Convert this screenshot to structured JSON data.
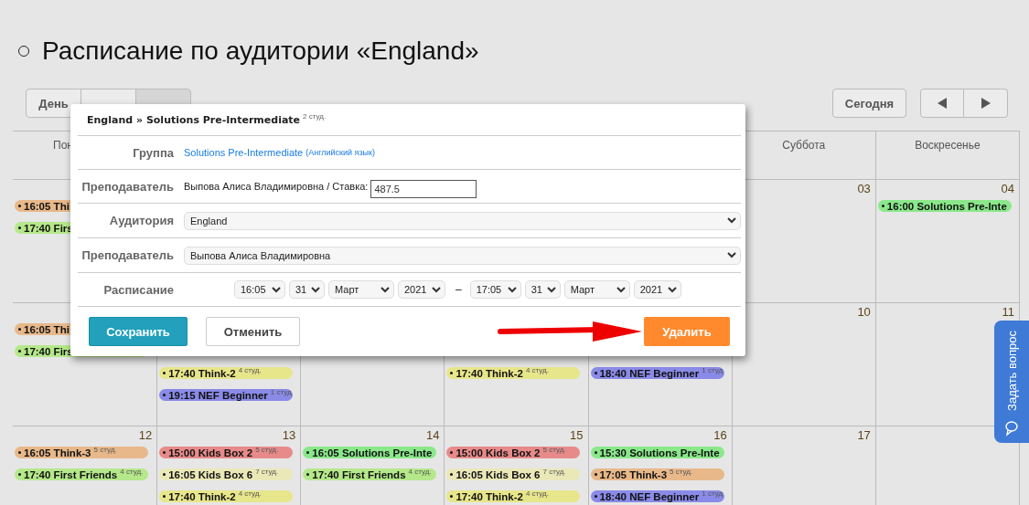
{
  "page_title": "Расписание по аудитории «England»",
  "view_tabs": [
    {
      "label": "День",
      "selected": false
    },
    {
      "selected": false
    },
    {
      "selected": true
    }
  ],
  "today_button": "Сегодня",
  "calendar": {
    "weekdays": {
      "monday": "Пон",
      "saturday": "Суббота",
      "sunday": "Воскресенье"
    },
    "weeks": [
      {
        "monday": {
          "events": [
            {
              "title": "16:05 Thi",
              "color": "#e8b88a"
            },
            {
              "title": "17:40 Firs",
              "color": "#b5e88a"
            }
          ]
        },
        "saturday": {
          "date": "03"
        },
        "sunday": {
          "date": "04",
          "events": [
            {
              "title": "16:00 Solutions Pre-Inte",
              "color": "#8ae88a"
            }
          ]
        }
      },
      {
        "monday": {
          "events": [
            {
              "title": "16:05 Thi",
              "color": "#e8b88a"
            },
            {
              "title": "17:40 Firs",
              "color": "#b5e88a"
            }
          ]
        },
        "tuesday": {
          "events": [
            {
              "title": "17:40 Think-2",
              "count": "4 студ.",
              "color": "#e8e68a"
            },
            {
              "title": "19:15 NEF Beginner",
              "count": "1 студ",
              "color": "#8a8ae8"
            }
          ]
        },
        "thursday": {
          "events": [
            {
              "title": "17:40 Think-2",
              "count": "4 студ.",
              "color": "#e8e68a"
            }
          ]
        },
        "friday": {
          "events": [
            {
              "title": "18:40 NEF Beginner",
              "count": "1 студ",
              "color": "#8a8ae8"
            }
          ]
        },
        "saturday": {
          "date": "10"
        },
        "sunday": {
          "date": "11"
        }
      },
      {
        "monday": {
          "date": "12",
          "events": [
            {
              "title": "16:05 Think-3",
              "count": "5 студ.",
              "color": "#e8b88a"
            },
            {
              "title": "17:40 First Friends",
              "count": "4 студ.",
              "color": "#b5e88a"
            }
          ]
        },
        "tuesday": {
          "date": "13",
          "events": [
            {
              "title": "15:00 Kids Box 2",
              "count": "5 студ.",
              "color": "#e88a8a"
            },
            {
              "title": "16:05 Kids Box 6",
              "count": "7 студ.",
              "color": "#ebe8b8"
            },
            {
              "title": "17:40 Think-2",
              "count": "4 студ.",
              "color": "#e8e68a"
            }
          ]
        },
        "wednesday": {
          "date": "14",
          "events": [
            {
              "title": "16:05 Solutions Pre-Inte",
              "color": "#8ae88a"
            },
            {
              "title": "17:40 First Friends",
              "count": "4 студ.",
              "color": "#b5e88a"
            }
          ]
        },
        "thursday": {
          "date": "15",
          "events": [
            {
              "title": "15:00 Kids Box 2",
              "count": "5 студ.",
              "color": "#e88a8a"
            },
            {
              "title": "16:05 Kids Box 6",
              "count": "7 студ.",
              "color": "#ebe8b8"
            },
            {
              "title": "17:40 Think-2",
              "count": "4 студ.",
              "color": "#e8e68a"
            }
          ]
        },
        "friday": {
          "date": "16",
          "events": [
            {
              "title": "15:30 Solutions Pre-Inte",
              "color": "#8ae88a"
            },
            {
              "title": "17:05 Think-3",
              "count": "5 студ.",
              "color": "#e8b88a"
            },
            {
              "title": "18:40 NEF Beginner",
              "count": "1 студ",
              "color": "#8a8ae8"
            }
          ]
        },
        "saturday": {
          "date": "17"
        }
      }
    ]
  },
  "dialog": {
    "title": "England » Solutions Pre-Intermediate",
    "title_count": "2 студ.",
    "rows": [
      {
        "kind": "link",
        "label": "Группа",
        "link": "Solutions Pre-Intermediate",
        "note": "(Английский язык)"
      },
      {
        "kind": "rate",
        "label": "Преподаватель",
        "text": "Выпова Алиса Владимировна / Ставка:",
        "value": "487.5"
      },
      {
        "kind": "select",
        "label": "Аудитория",
        "value": "England"
      },
      {
        "kind": "select",
        "label": "Преподаватель",
        "value": "Выпова Алиса Владимировна"
      },
      {
        "kind": "range",
        "label": "Расписание",
        "from": [
          "16:05",
          "31",
          "Март",
          "2021"
        ],
        "separator": "–",
        "to": [
          "17:05",
          "31",
          "Март",
          "2021"
        ]
      }
    ],
    "buttons": [
      {
        "kind": "primary",
        "label": "Сохранить"
      },
      {
        "kind": "secondary",
        "label": "Отменить"
      },
      {
        "kind": "danger",
        "label": "Удалить"
      }
    ]
  },
  "ask_tab": {
    "label": "Задать вопрос"
  }
}
